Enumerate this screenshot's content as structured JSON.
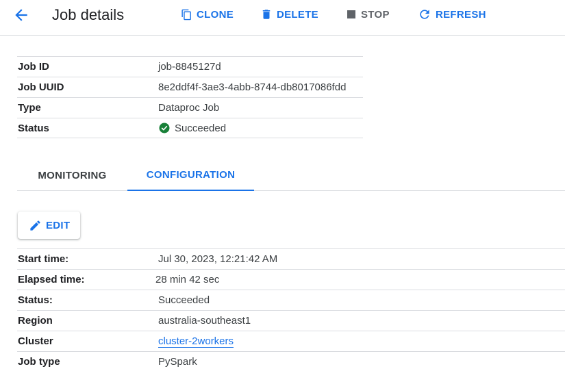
{
  "header": {
    "title": "Job details",
    "back_icon": "arrow-back-icon",
    "actions": [
      {
        "label": "CLONE",
        "icon": "copy-icon"
      },
      {
        "label": "DELETE",
        "icon": "trash-icon"
      },
      {
        "label": "STOP",
        "icon": "stop-square-icon"
      },
      {
        "label": "REFRESH",
        "icon": "refresh-icon"
      }
    ]
  },
  "summary": {
    "rows": [
      {
        "key": "Job ID",
        "value": "job-8845127d"
      },
      {
        "key": "Job UUID",
        "value": "8e2ddf4f-3ae3-4abb-8744-db8017086fdd"
      },
      {
        "key": "Type",
        "value": "Dataproc Job"
      },
      {
        "key": "Status",
        "value": "Succeeded",
        "status_icon": "check-circle-icon"
      }
    ]
  },
  "tabs": [
    {
      "label": "MONITORING",
      "selected": false
    },
    {
      "label": "CONFIGURATION",
      "selected": true
    }
  ],
  "edit_button": {
    "label": "EDIT",
    "icon": "pencil-icon"
  },
  "configuration": {
    "rows": [
      {
        "key": "Start time:",
        "value": "Jul 30, 2023, 12:21:42 AM"
      },
      {
        "key": "Elapsed time:",
        "value": "28 min 42 sec"
      },
      {
        "key": "Status:",
        "value": "Succeeded"
      },
      {
        "key": "Region",
        "value": "australia-southeast1"
      },
      {
        "key": "Cluster",
        "value": "cluster-2workers",
        "is_link": true
      },
      {
        "key": "Job type",
        "value": "PySpark"
      }
    ]
  },
  "colors": {
    "accent": "#1a73e8",
    "success": "#188038",
    "divider": "#dadce0",
    "muted": "#5f6368"
  }
}
